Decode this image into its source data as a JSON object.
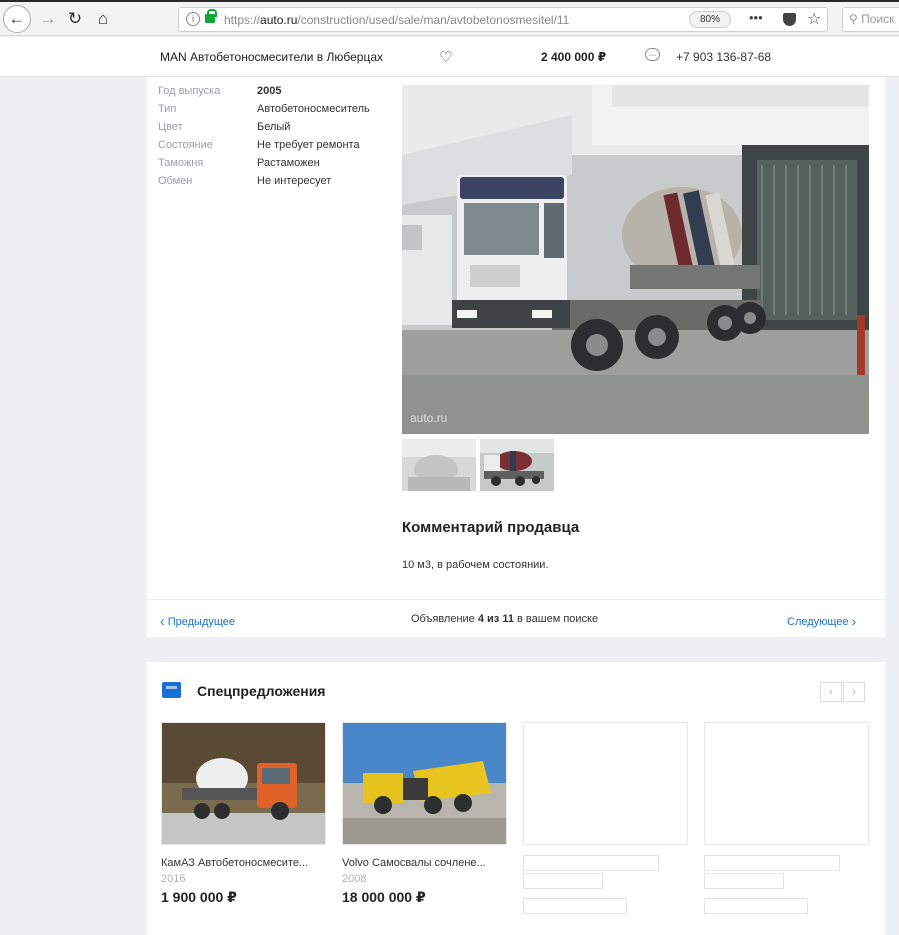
{
  "browser": {
    "url_domain": "auto.ru",
    "url_rest": "/construction/used/sale/man/avtobetonosmesitel/11",
    "url_prefix": "https://",
    "zoom": "80%",
    "search_placeholder": "Поиск"
  },
  "header": {
    "title": "MAN Автобетоносмесители в Люберцах",
    "price": "2 400 000 ₽",
    "phone": "+7 903 136-87-68"
  },
  "specs": [
    {
      "key": "Год выпуска",
      "value": "2005"
    },
    {
      "key": "Тип",
      "value": "Автобетоносмеситель"
    },
    {
      "key": "Цвет",
      "value": "Белый"
    },
    {
      "key": "Состояние",
      "value": "Не требует ремонта"
    },
    {
      "key": "Таможня",
      "value": "Растаможен"
    },
    {
      "key": "Обмен",
      "value": "Не интересует"
    }
  ],
  "photo": {
    "watermark": "auto.ru"
  },
  "comment": {
    "title": "Комментарий продавца",
    "text": "10 м3, в рабочем состоянии."
  },
  "pager": {
    "prev": "Предыдущее",
    "text_before": "Объявление",
    "current": "4 из 11",
    "text_after": "в вашем поиске",
    "next": "Следующее"
  },
  "offers": {
    "title": "Спецпредложения",
    "items": [
      {
        "name": "КамАЗ Автобетоносмесите...",
        "year": "2016",
        "price": "1 900 000 ₽"
      },
      {
        "name": "Volvo Самосвалы сочлене...",
        "year": "2008",
        "price": "18 000 000 ₽"
      }
    ]
  },
  "colors": {
    "link": "#1a73c9",
    "accent": "#1a6fd6",
    "secure": "#12a53a"
  }
}
